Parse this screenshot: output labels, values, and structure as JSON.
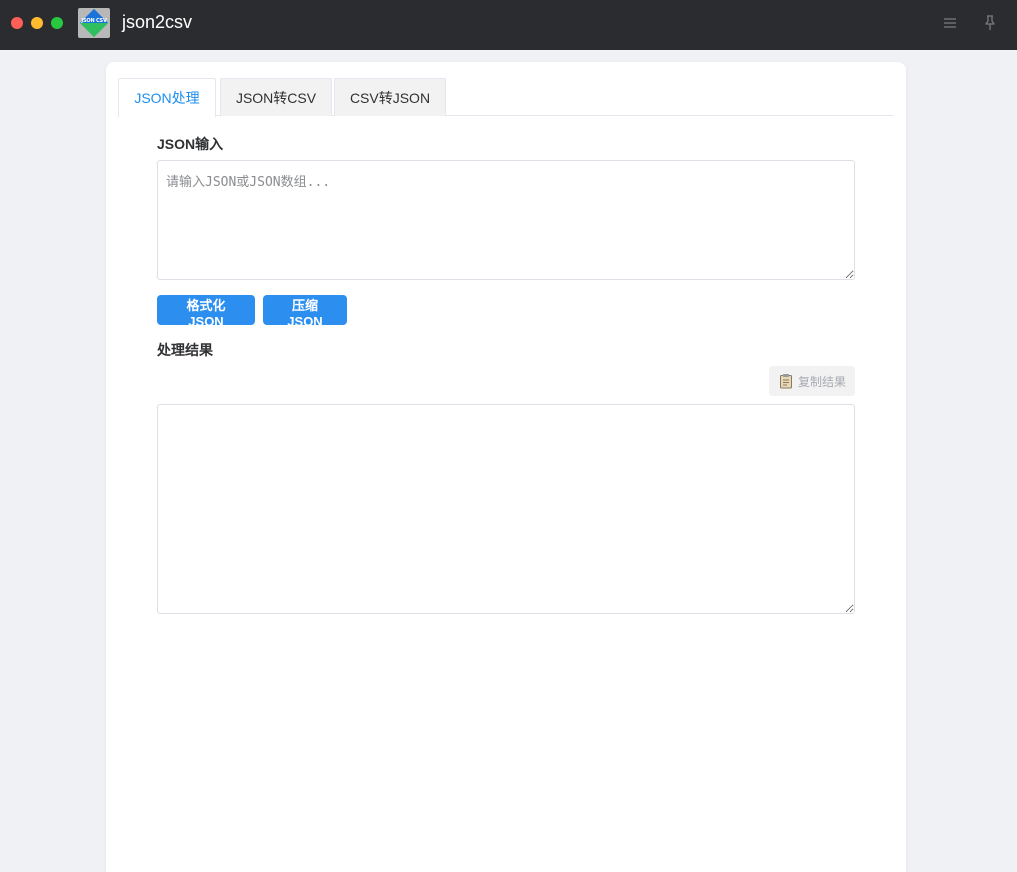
{
  "window": {
    "title": "json2csv",
    "icon_text": "JSON CSV",
    "icons": [
      "close-dot",
      "minimize-dot",
      "maximize-dot",
      "app-logo",
      "menu-icon",
      "pin-icon"
    ]
  },
  "tabs": [
    {
      "label": "JSON处理",
      "active": true
    },
    {
      "label": "JSON转CSV",
      "active": false
    },
    {
      "label": "CSV转JSON",
      "active": false
    }
  ],
  "input": {
    "label": "JSON输入",
    "placeholder": "请输入JSON或JSON数组...",
    "value": ""
  },
  "actions": {
    "format_label": "格式化JSON",
    "compress_label": "压缩JSON"
  },
  "result": {
    "label": "处理结果",
    "copy_label": "复制结果",
    "copy_enabled": false,
    "value": ""
  },
  "colors": {
    "accent": "#2c8ff0",
    "active_tab_text": "#1e8ff0",
    "titlebar": "#2b2c2f",
    "background": "#f0f1f5"
  }
}
